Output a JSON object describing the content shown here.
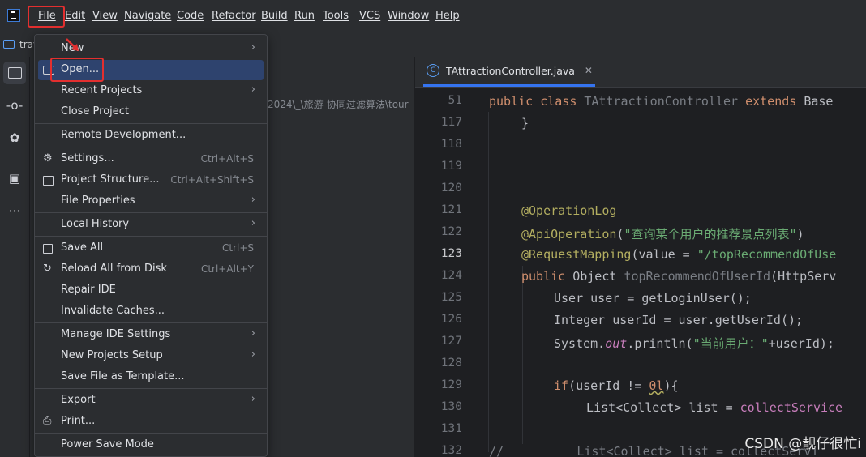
{
  "menubar": {
    "items": [
      "File",
      "Edit",
      "View",
      "Navigate",
      "Code",
      "Refactor",
      "Build",
      "Run",
      "Tools",
      "VCS",
      "Window",
      "Help"
    ]
  },
  "project_chip": "trav",
  "project_path": "2024\\_\\旅游-协同过滤算法\\tour-",
  "editor": {
    "tab_title": "TAttractionController.java",
    "line_numbers": [
      "51",
      "117",
      "118",
      "119",
      "120",
      "121",
      "122",
      "123",
      "124",
      "125",
      "126",
      "127",
      "128",
      "129",
      "130",
      "131",
      "132"
    ],
    "current_line": "123"
  },
  "file_menu": {
    "items": [
      {
        "label": "New",
        "shortcut": "",
        "submenu": true
      },
      {
        "label": "Open...",
        "shortcut": "",
        "submenu": false
      },
      {
        "label": "Recent Projects",
        "shortcut": "",
        "submenu": true
      },
      {
        "label": "Close Project",
        "shortcut": "",
        "submenu": false
      },
      {
        "label": "Remote Development...",
        "shortcut": "",
        "submenu": false
      },
      {
        "label": "Settings...",
        "shortcut": "Ctrl+Alt+S",
        "submenu": false
      },
      {
        "label": "Project Structure...",
        "shortcut": "Ctrl+Alt+Shift+S",
        "submenu": false
      },
      {
        "label": "File Properties",
        "shortcut": "",
        "submenu": true
      },
      {
        "label": "Local History",
        "shortcut": "",
        "submenu": true
      },
      {
        "label": "Save All",
        "shortcut": "Ctrl+S",
        "submenu": false
      },
      {
        "label": "Reload All from Disk",
        "shortcut": "Ctrl+Alt+Y",
        "submenu": false
      },
      {
        "label": "Repair IDE",
        "shortcut": "",
        "submenu": false
      },
      {
        "label": "Invalidate Caches...",
        "shortcut": "",
        "submenu": false
      },
      {
        "label": "Manage IDE Settings",
        "shortcut": "",
        "submenu": true
      },
      {
        "label": "New Projects Setup",
        "shortcut": "",
        "submenu": true
      },
      {
        "label": "Save File as Template...",
        "shortcut": "",
        "submenu": false
      },
      {
        "label": "Export",
        "shortcut": "",
        "submenu": true
      },
      {
        "label": "Print...",
        "shortcut": "",
        "submenu": false
      },
      {
        "label": "Power Save Mode",
        "shortcut": "",
        "submenu": false
      }
    ]
  },
  "code": {
    "l51": {
      "a": "public class ",
      "b": "TAttractionController ",
      "c": "extends ",
      "d": "Base"
    },
    "l117": "}",
    "l121": "@OperationLog",
    "l122": {
      "a": "@ApiOperation",
      "b": "(",
      "c": "\"查询某个用户的推荐景点列表\"",
      "d": ")"
    },
    "l123": {
      "a": "@RequestMapping",
      "b": "(value = ",
      "c": "\"/topRecommendOfUse"
    },
    "l124": {
      "a": "public ",
      "b": "Object ",
      "c": "topRecommendOfUserId",
      "d": "(HttpServ"
    },
    "l125": {
      "a": "User user = ",
      "b": "getLoginUser",
      "c": "();"
    },
    "l126": {
      "a": "Integer userId = user.",
      "b": "getUserId",
      "c": "();"
    },
    "l127": {
      "a": "System.",
      "b": "out",
      "c": ".println(",
      "d": "\"当前用户：\"",
      "e": "+userId);"
    },
    "l129": {
      "a": "if",
      "b": "(userId != ",
      "c": "0l",
      "d": "){"
    },
    "l130": {
      "a": "List<Collect> list = ",
      "b": "collectService"
    },
    "l132": {
      "a": "//",
      "b": "          List<Collect> list = collectServi"
    }
  },
  "watermark": "CSDN @靓仔很忙i",
  "colors": {
    "accent": "#3574f0",
    "highlight_box": "#e32f2f",
    "menu_selected": "#2e436e"
  }
}
